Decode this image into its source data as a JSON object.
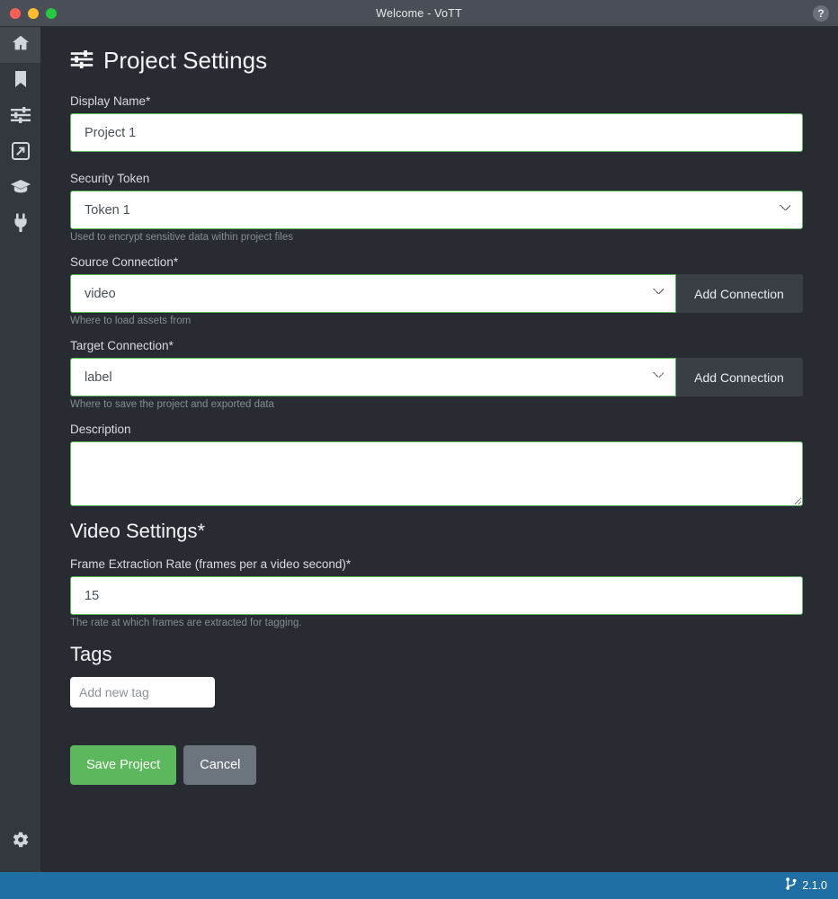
{
  "titlebar": {
    "title": "Welcome - VoTT",
    "help_icon": "help-circle-icon",
    "help_label": "?",
    "traffic_lights": [
      "close",
      "minimize",
      "maximize"
    ]
  },
  "sidebar": {
    "items": [
      {
        "name": "home",
        "icon": "home-icon",
        "active": true
      },
      {
        "name": "projects",
        "icon": "bookmark-icon",
        "active": false
      },
      {
        "name": "active-learning",
        "icon": "sliders-icon",
        "active": false
      },
      {
        "name": "export",
        "icon": "export-arrow-icon",
        "active": false
      },
      {
        "name": "training",
        "icon": "graduation-cap-icon",
        "active": false
      },
      {
        "name": "connections",
        "icon": "plug-icon",
        "active": false
      }
    ],
    "settings": {
      "name": "application-settings",
      "icon": "gear-icon"
    }
  },
  "page": {
    "title": "Project Settings",
    "title_icon": "sliders-icon"
  },
  "form": {
    "display_name": {
      "label": "Display Name*",
      "value": "Project 1",
      "placeholder": ""
    },
    "security_token": {
      "label": "Security Token",
      "value": "Token 1",
      "options": [
        "Token 1"
      ],
      "helper": "Used to encrypt sensitive data within project files"
    },
    "source_connection": {
      "label": "Source Connection*",
      "value": "video",
      "options": [
        "video"
      ],
      "helper": "Where to load assets from",
      "button_label": "Add Connection"
    },
    "target_connection": {
      "label": "Target Connection*",
      "value": "label",
      "options": [
        "label"
      ],
      "helper": "Where to save the project and exported data",
      "button_label": "Add Connection"
    },
    "description": {
      "label": "Description",
      "value": "",
      "placeholder": ""
    },
    "video_settings": {
      "heading": "Video Settings*",
      "frame_rate": {
        "label": "Frame Extraction Rate (frames per a video second)*",
        "value": "15",
        "helper": "The rate at which frames are extracted for tagging."
      }
    },
    "tags": {
      "heading": "Tags",
      "input_placeholder": "Add new tag",
      "input_value": "",
      "items": []
    },
    "actions": {
      "save_label": "Save Project",
      "cancel_label": "Cancel"
    }
  },
  "statusbar": {
    "branch_icon": "git-branch-icon",
    "version": "2.1.0"
  },
  "colors": {
    "accent_green": "#5cb85c",
    "statusbar_blue": "#1f6fa5",
    "background": "#282c32",
    "sidebar": "#33373e",
    "titlebar": "#4a4f57",
    "cancel_gray": "#6c757d"
  }
}
